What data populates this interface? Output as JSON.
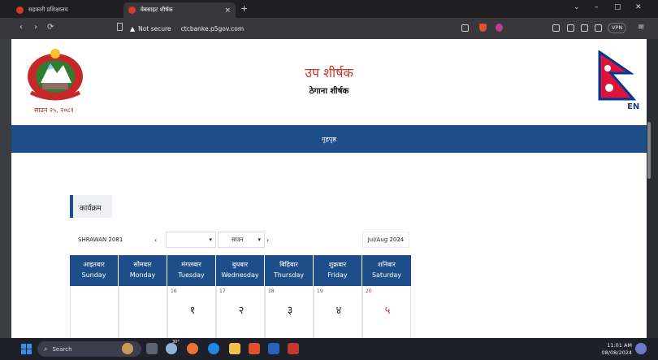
{
  "browser": {
    "tabs": [
      {
        "label": "सहकारी प्रशिक्षालय",
        "active": false
      },
      {
        "label": "वेबसाइट शीर्षक",
        "active": true
      }
    ],
    "new_tab": "+",
    "close": "×",
    "window_controls": {
      "chevron": "⌄",
      "minimize": "–",
      "maximize": "▢",
      "close": "✕"
    },
    "nav": {
      "back": "‹",
      "forward": "›",
      "reload": "⟳"
    },
    "security_label": "Not secure",
    "url": "ctcbanke.p5gov.com",
    "vpn_label": "VPN",
    "menu_icon": "≡"
  },
  "header": {
    "emblem_date": "साउन २५, २०८१",
    "title": "उप शीर्षक",
    "subtitle": "ठेगाना शीर्षक",
    "language_toggle": "EN"
  },
  "navbar": {
    "home": "गृहपृष्ठ"
  },
  "section": {
    "title": "कार्यक्रम"
  },
  "calendar_controls": {
    "bs_month": "SHRAWAN 2081",
    "prev": "‹",
    "year_select_value": "",
    "month_select_value": "साउन",
    "next": "›",
    "ad_range": "Jul/Aug 2024"
  },
  "calendar": {
    "days": [
      {
        "np": "आइतबार",
        "en": "Sunday"
      },
      {
        "np": "सोमबार",
        "en": "Monday"
      },
      {
        "np": "मंगलबार",
        "en": "Tuesday"
      },
      {
        "np": "बुधबार",
        "en": "Wednesday"
      },
      {
        "np": "बिहिबार",
        "en": "Thursday"
      },
      {
        "np": "शुक्रबार",
        "en": "Friday"
      },
      {
        "np": "शनिबार",
        "en": "Saturday"
      }
    ],
    "first_week": [
      {
        "ad": "",
        "bs": ""
      },
      {
        "ad": "",
        "bs": ""
      },
      {
        "ad": "16",
        "bs": "१"
      },
      {
        "ad": "17",
        "bs": "२"
      },
      {
        "ad": "18",
        "bs": "३"
      },
      {
        "ad": "19",
        "bs": "४"
      },
      {
        "ad": "20",
        "bs": "५"
      }
    ],
    "weekend_color": "#d32f2f",
    "header_color": "#1d4e89"
  },
  "taskbar": {
    "search_label": "Search",
    "time": "11:01 AM",
    "date": "08/08/2024",
    "weather": "30°"
  }
}
